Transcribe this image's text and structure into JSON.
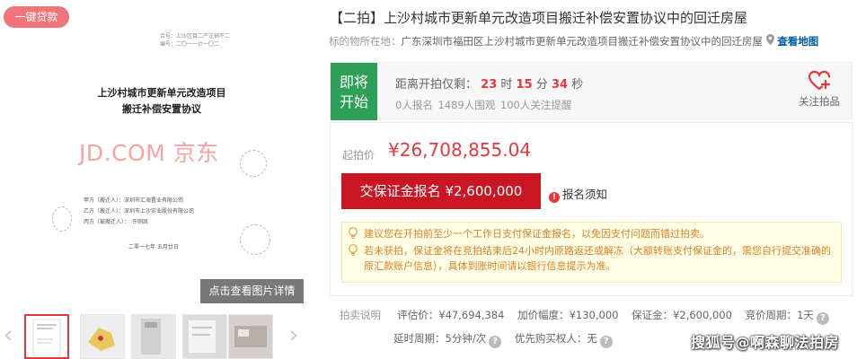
{
  "gallery": {
    "loan_tag": "一键贷款",
    "document": {
      "header_lines": [
        "合号：上沙区目二产注销不二",
        "编号：二〇一一计一〇二"
      ],
      "title_lines": [
        "上沙村城市更新单元改造项目",
        "搬迁补偿安置协议"
      ],
      "watermark_logo": "JD.COM 京东",
      "parties": [
        "甲方（搬迁人）：深圳市汇海置业有限公司",
        "乙方（搬迁人）：深圳市上沙实业股份有限公司",
        "丙方（被搬迁人）：　许刚凯"
      ],
      "date": "二零一七年 五月廿日"
    },
    "zoom_button": "点击查看图片详情",
    "prev_arrow": "‹",
    "next_arrow": "›"
  },
  "item": {
    "title": "【二拍】上沙村城市更新单元改造项目搬迁补偿安置协议中的回迁房屋",
    "location_label": "标的物所在地：",
    "location_value": "广东深圳市福田区上沙村城市更新单元改造项目搬迁补偿安置协议中的回迁房屋",
    "map_link": "查看地图"
  },
  "status": {
    "tag_line1": "即将",
    "tag_line2": "开始",
    "countdown_prefix": "距离开拍仅剩：",
    "hours": "23",
    "hours_unit": "时",
    "minutes": "15",
    "minutes_unit": "分",
    "seconds": "34",
    "seconds_unit": "秒",
    "stats": "0人报名  1489人围观  100人关注提醒",
    "favorite_label": "关注拍品"
  },
  "price": {
    "start_label": "起拍价",
    "start_value": "¥26,708,855.04",
    "deposit_button": "交保证金报名 ¥2,600,000",
    "notice_icon": "!",
    "notice_link": "报名须知",
    "tips": [
      "建议您在开拍前至少一个工作日支付保证金报名，以免因支付问题而错过拍卖。",
      "若未获拍，保证金将在竞拍结束后24小时内原路返还或解冻（大额转账支付保证金的，需您自行提交准确的原汇款账户信息），具体到账时间请以银行信息提示为准。"
    ]
  },
  "rules": {
    "section_label": "拍卖说明",
    "appraisal_label": "评估价：",
    "appraisal_value": "¥47,694,384",
    "increment_label": "加价幅度：",
    "increment_value": "¥130,000",
    "deposit_label": "保证金：",
    "deposit_value": "¥2,600,000",
    "cycle_label": "竞价周期：",
    "cycle_value": "1天",
    "delay_label": "延时周期：",
    "delay_value": "5分钟/次",
    "priority_label": "优先购买权人：",
    "priority_value": "无",
    "help_icon": "?"
  },
  "watermark": "搜狐号@啊森聊法拍房",
  "colors": {
    "accent_red": "#e4393c",
    "button_red": "#c81623",
    "status_green": "#2d9f57",
    "tip_orange": "#d9822b",
    "link_blue": "#005ea7"
  }
}
